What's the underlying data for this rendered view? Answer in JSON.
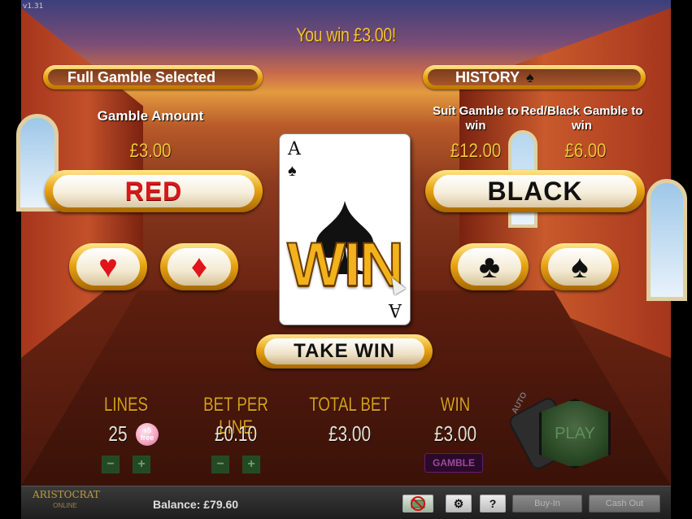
{
  "version": "v1.31",
  "win_message": "You win £3.00!",
  "gamble_mode_label": "Full Gamble Selected",
  "history_label": "HISTORY",
  "labels": {
    "gamble_amount": "Gamble Amount",
    "suit_gamble": "Suit Gamble to win",
    "red_black_gamble": "Red/Black Gamble to win"
  },
  "amounts": {
    "gamble_amount": "£3.00",
    "suit_gamble": "£12.00",
    "red_black_gamble": "£6.00"
  },
  "buttons": {
    "red": "RED",
    "black": "BLACK",
    "take_win": "TAKE WIN",
    "play": "PLAY",
    "auto": "AUTO",
    "gamble": "GAMBLE",
    "buy_in": "Buy-In",
    "cash_out": "Cash Out",
    "help": "?"
  },
  "suits": {
    "heart": "♥",
    "diamond": "♦",
    "club": "♣",
    "spade": "♠"
  },
  "card": {
    "rank": "A",
    "suit": "♠"
  },
  "result_text": "WIN",
  "stats": {
    "lines_label": "LINES",
    "lines_value": "25",
    "lines_badge": "+5 free",
    "bet_per_line_label": "BET PER LINE",
    "bet_per_line_value": "£0.10",
    "total_bet_label": "TOTAL BET",
    "total_bet_value": "£3.00",
    "win_label": "WIN",
    "win_value": "£3.00"
  },
  "footer": {
    "logo_main": "ARISTOCRAT",
    "logo_sub": "ONLINE",
    "balance": "Balance: £79.60"
  },
  "colors": {
    "gold": "#e8a514",
    "red_text": "#d7181a",
    "money_text": "#f0c23a"
  }
}
